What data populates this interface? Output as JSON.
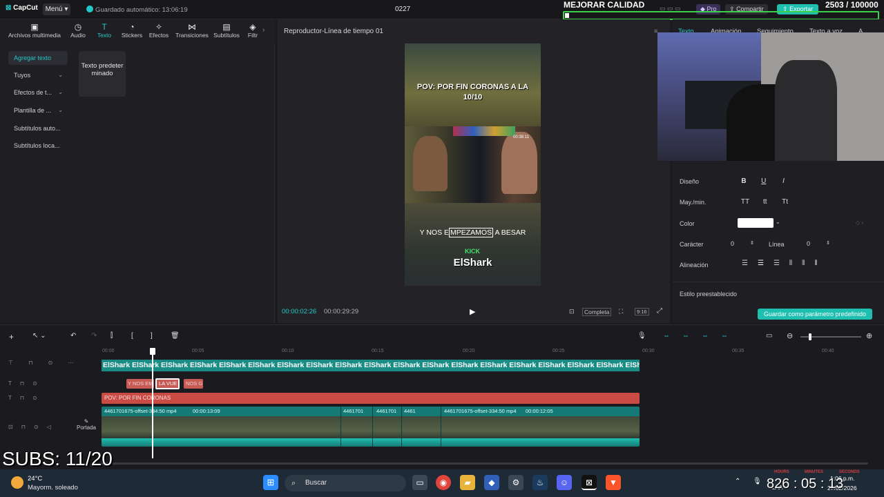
{
  "app": {
    "name": "CapCut",
    "menu_label": "Menú",
    "autosave": "Guardado automático: 13:06:19",
    "project_name": "0227"
  },
  "overlay": {
    "quality_text": "MEJORAR CALIDAD",
    "counter": "2503 / 100000",
    "subs": "SUBS: 11/20",
    "clock_digits": "826 : 05 : 13",
    "clock_units": [
      "HOURS",
      "MINUTES",
      "SECONDS"
    ]
  },
  "topbar_buttons": {
    "pro": "Pro",
    "share": "Compartir",
    "export": "Exportar"
  },
  "toolbar": [
    {
      "label": "Archivos multimedia",
      "icon": "media-icon"
    },
    {
      "label": "Audio",
      "icon": "audio-icon"
    },
    {
      "label": "Texto",
      "icon": "text-icon"
    },
    {
      "label": "Stickers",
      "icon": "sticker-icon"
    },
    {
      "label": "Efectos",
      "icon": "effects-icon"
    },
    {
      "label": "Transiciones",
      "icon": "transitions-icon"
    },
    {
      "label": "Subtítulos",
      "icon": "subtitles-icon"
    },
    {
      "label": "Filtr",
      "icon": "filters-icon"
    }
  ],
  "left_nav": [
    {
      "label": "Agregar texto"
    },
    {
      "label": "Tuyos"
    },
    {
      "label": "Efectos de t..."
    },
    {
      "label": "Plantilla de ..."
    },
    {
      "label": "Subtítulos auto..."
    },
    {
      "label": "Subtítulos loca..."
    }
  ],
  "default_text_card": "Texto predeterminado",
  "player": {
    "title": "Reproductor-Línea de tiempo 01",
    "caption_top": "POV: POR FIN CORONAS A LA 10/10",
    "caption_bottom_pre": "Y NOS E",
    "caption_bottom_sel": "MPEZAMOS",
    "caption_bottom_post": " A BESAR",
    "watermark": "ElShark",
    "video_timestamp": "00:38:11",
    "current_time": "00:00:02:26",
    "total_time": "00:00:29:29",
    "quality_label": "Completa",
    "ratio_label": "9:16"
  },
  "right_panel": {
    "tabs": [
      "Texto",
      "Animación",
      "Seguimiento",
      "Texto a voz",
      "A"
    ],
    "rows": [
      {
        "label": "Diseño",
        "options": [
          "B",
          "U",
          "I"
        ]
      },
      {
        "label": "May./min.",
        "options": [
          "TT",
          "tt",
          "Tt"
        ]
      },
      {
        "label": "Color"
      },
      {
        "label": "Carácter",
        "value": "0"
      },
      {
        "label": "Línea",
        "value": "0"
      },
      {
        "label": "Alineación"
      }
    ],
    "preset_label": "Estilo preestablecido",
    "save_preset_button": "Guardar como parámetro predefinido"
  },
  "timeline": {
    "ruler": [
      "00:00",
      "00:05",
      "00:10",
      "00:15",
      "00:20",
      "00:25",
      "00:30",
      "00:35",
      "00:40"
    ],
    "watermark_track": "ElShark ElShark ElShark ElShark ElShark ElShark ElShark ElShark ElShark ElShark ElShark ElShark ElShark ElShark ElShark ElShark ElShark ElShark ElShark ElShark ElSl",
    "text_clips": [
      "Y NOS EM",
      "LA VUE",
      "NOS G"
    ],
    "caption_clip": "POV: POR FIN CORONAS",
    "video_clip_1_name": "4461701675-offset-334:50 mp4",
    "video_clip_1_duration": "00:00:13:09",
    "video_clip_2_name": "4461701675-offset-334:50 mp4",
    "video_clip_2_duration": "00:00:12:05",
    "video_clip_short": [
      "4461701",
      "4461701",
      "4461"
    ],
    "cover_label": "Portada"
  },
  "taskbar": {
    "weather_temp": "24°C",
    "weather_desc": "Mayorm. soleado",
    "search": "Buscar",
    "lang": "LAA",
    "time": "1:06 p.m.",
    "date": "27/02/2026"
  },
  "colors": {
    "accent": "#24c8c8",
    "caption_clip": "#c94b44",
    "text_clip": "#c75a55",
    "video_clip": "#1a8c86",
    "export": "#1fbfb0"
  }
}
